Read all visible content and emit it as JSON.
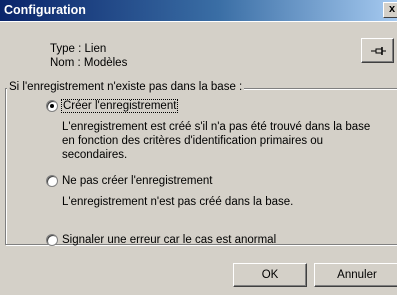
{
  "window": {
    "title": "Configuration",
    "close_glyph": "x"
  },
  "info": {
    "type_line": "Type : Lien",
    "nom_line": "Nom : Modèles"
  },
  "pin_button": {
    "icon": "pin-icon"
  },
  "group": {
    "label": "Si l'enregistrement n'existe pas dans la base :",
    "options": [
      {
        "label": "Créer l'enregistrement",
        "checked": true,
        "description": [
          "L'enregistrement est créé s'il n'a pas été trouvé dans la base",
          "en fonction des critères d'identification primaires ou",
          "secondaires."
        ]
      },
      {
        "label": "Ne pas créer l'enregistrement",
        "checked": false,
        "description": [
          "L'enregistrement n'est pas créé dans la base."
        ]
      },
      {
        "label": "Signaler une erreur car le cas est anormal",
        "checked": false,
        "description": []
      }
    ]
  },
  "buttons": {
    "ok": "OK",
    "cancel": "Annuler"
  }
}
